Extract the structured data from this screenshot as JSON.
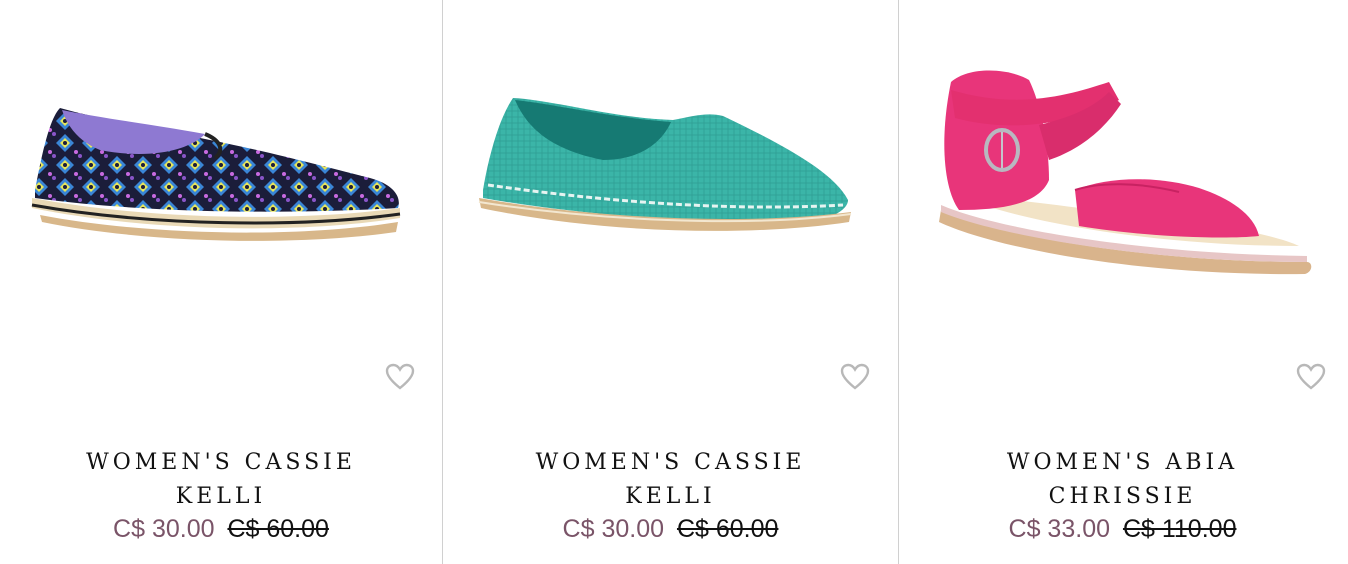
{
  "products": [
    {
      "title_line1": "WOMEN'S CASSIE",
      "title_line2": "KELLI",
      "sale_price": "C$ 30.00",
      "original_price": "C$ 60.00",
      "image_icon": "patterned-slip-on-shoe",
      "wishlist_icon": "heart-outline-icon"
    },
    {
      "title_line1": "WOMEN'S CASSIE",
      "title_line2": "KELLI",
      "sale_price": "C$ 30.00",
      "original_price": "C$ 60.00",
      "image_icon": "teal-slip-on-shoe",
      "wishlist_icon": "heart-outline-icon"
    },
    {
      "title_line1": "WOMEN'S ABIA",
      "title_line2": "CHRISSIE",
      "sale_price": "C$ 33.00",
      "original_price": "C$ 110.00",
      "image_icon": "pink-sandal",
      "wishlist_icon": "heart-outline-icon"
    }
  ],
  "colors": {
    "sale_price": "#7a5468",
    "divider": "#d0d0d0",
    "heart": "#b8b8b8"
  }
}
